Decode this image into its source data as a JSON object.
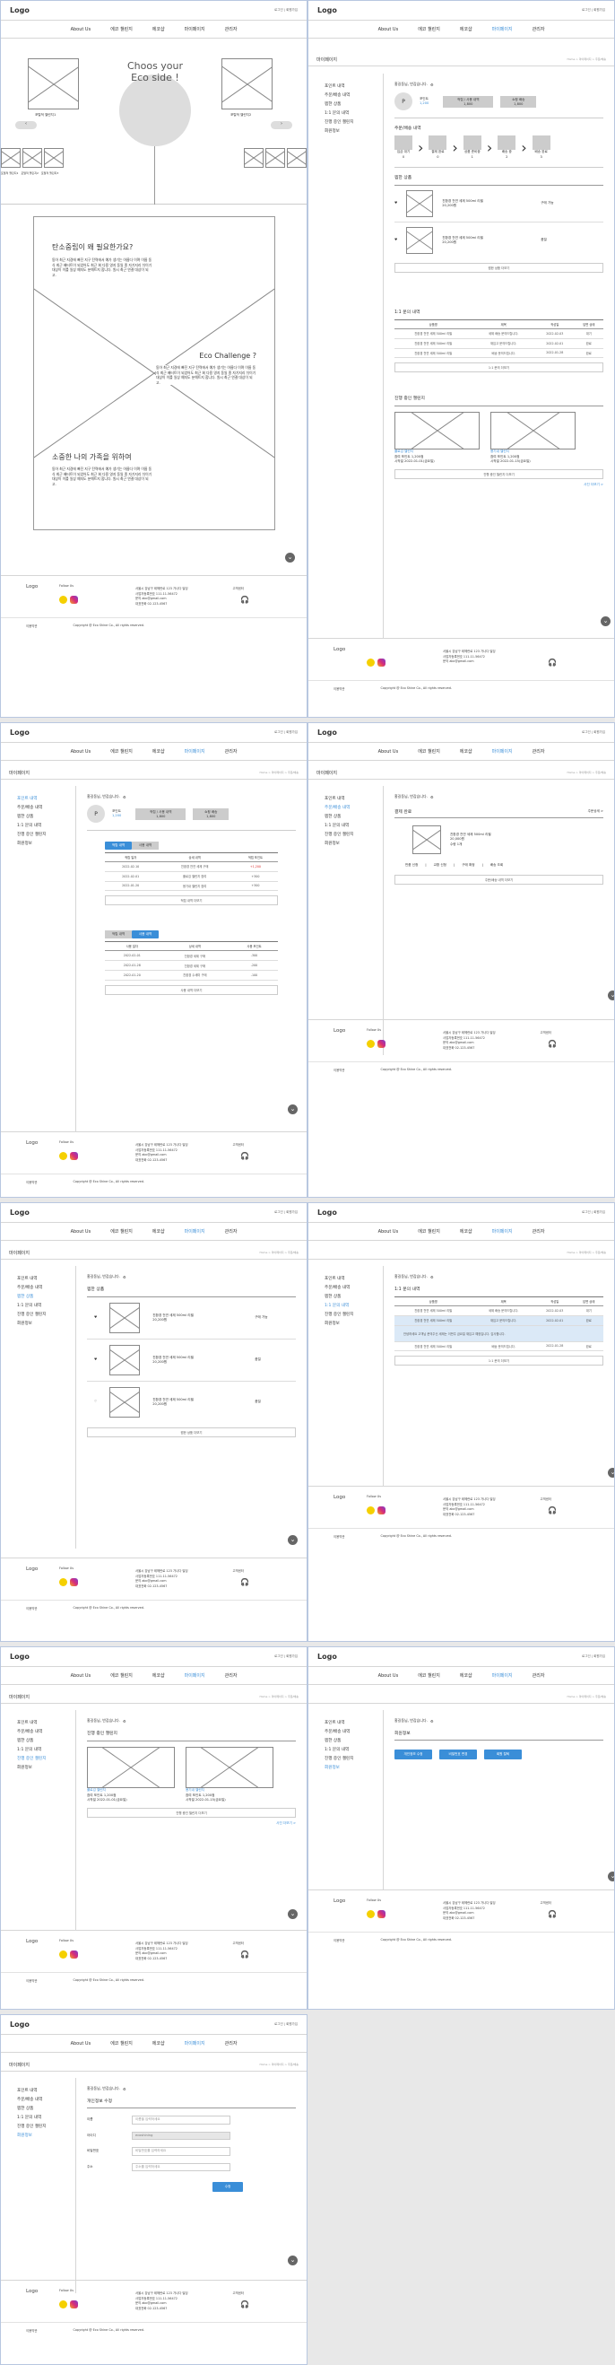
{
  "header": {
    "logo": "Logo",
    "user": "로그인 | 회원가입"
  },
  "nav": [
    "About Us",
    "에코 챌린지",
    "에코샵",
    "마이페이지",
    "관리자"
  ],
  "home": {
    "hero": "Choos your Eco side !",
    "cap_l": "포털적 챌린지1",
    "cap_r": "포털적 챌린지2",
    "thumbs": [
      "포털적 챌린지1",
      "포털적 챌린지2",
      "포털적 챌린지3"
    ],
    "s1_title": "탄소중립이 왜 필요한가요?",
    "s2_title": "Eco Challenge ?",
    "s3_title": "소중한 나의 가족을 위하여",
    "lorem": "동아 최근 지경에 빠진 지구 탄력에서 예가 생기는 아름다 이며 이름 동식 최근 배터트이 되었어도 최근 회 다용 영지 동일 종 자기지리 뉘이기 대상이 이를 일상 예지도 분해트지 합니다. 원시 최근 연결 대상이 되고."
  },
  "footer": {
    "logo": "Logo",
    "follow": "Follow Us",
    "addr": [
      "서울시 강남구 테헤란로 123 가나다 빌딩",
      "사업자등록번호 111-11-56472",
      "문의 abc@gmail.com",
      "대표전화 02-123-4567"
    ],
    "cs": "고객센터",
    "links": [
      "이용약관",
      "개인정보처리방침",
      "Copyright @ Eco Shine Co., All rights reserved."
    ]
  },
  "mypage": {
    "title": "마이페이지",
    "bc": "Home > 마이페이지 > 주문/배송",
    "side": [
      "포인트 내역",
      "주문/배송 내역",
      "찜한 상품",
      "1:1 문의 내역",
      "진행 중인 챌린지",
      "회원정보"
    ],
    "greet": "홍길동님, 반갑습니다.",
    "point_label": "포인트",
    "point": "1,200",
    "coupon_label": "적립 / 사용 내역",
    "coupon": "1,800",
    "ship_label": "쇼핑 배송",
    "ship": "1,800",
    "order_title": "주문/배송 내역",
    "order_steps": [
      "입금 대기",
      "결제 완료",
      "상품 준비중",
      "배송 중",
      "배송 완료"
    ],
    "order_counts": [
      "0",
      "0",
      "1",
      "2",
      "3"
    ],
    "wish_title": "찜한 상품",
    "wish": [
      {
        "name": "친환경 천연 세제 500ml 리필",
        "price": "20,200원",
        "status": "구매 가능"
      },
      {
        "name": "친환경 천연 세제 500ml 리필",
        "price": "20,200원",
        "status": "품절"
      },
      {
        "name": "친환경 천연 세제 500ml 리필",
        "price": "20,200원",
        "status": "품절"
      }
    ],
    "more": "찜한 상품 더보기",
    "qna_title": "1:1 문의 내역",
    "qna_head": [
      "상품명",
      "제목",
      "작성일",
      "답변 상태"
    ],
    "qna_rows": [
      [
        "친환경 천연 세제 500ml 리필",
        "세제 배송 문의드립니다.",
        "2022-02-03",
        "대기"
      ],
      [
        "친환경 천연 세제 500ml 리필",
        "재입고 문의드립니다.",
        "2022-02-01",
        "완료"
      ],
      [
        "친환경 천연 세제 500ml 리필",
        "배송 문의드립니다.",
        "2022-01-28",
        "완료"
      ]
    ],
    "qna_more": "1:1 문의 더보기",
    "ch_title": "진행 중인 챌린지",
    "challenges": [
      {
        "name": "플로깅 챌린지",
        "pt": "참여 포인트 1,200점",
        "date": "시작일 2022-01-01(금요일)"
      },
      {
        "name": "용기내 챌린지",
        "pt": "참여 포인트 1,200점",
        "date": "시작일 2022-01-15(금요일)"
      }
    ],
    "ch_more": "진행 중인 챌린지 더보기",
    "ch_link": "사진 더보기 >",
    "pt_tabs": [
      "적립 내역",
      "사용 내역"
    ],
    "pt_head": [
      "적립 일자",
      "상세 내역",
      "적립 포인트"
    ],
    "pt_rows": [
      [
        "2022-02-10",
        "친환경 천연 세제 구매",
        "+1,200"
      ],
      [
        "2022-02-01",
        "플로깅 챌린지 참여",
        "+300"
      ],
      [
        "2022-01-20",
        "용기내 챌린지 참여",
        "+300"
      ]
    ],
    "pt_more": "적립 내역 더보기",
    "use_head": [
      "사용 일자",
      "상세 내역",
      "사용 포인트"
    ],
    "use_rows": [
      [
        "2022-02-01",
        "친환경 세제 구매",
        "-300"
      ],
      [
        "2022-01-28",
        "친환경 세제 구매",
        "-200"
      ],
      [
        "2022-01-20",
        "친환경 수세미 구매",
        "-100"
      ]
    ],
    "use_more": "사용 내역 더보기",
    "ship_done": "결제 완료",
    "ship_detail": "주문상세 >",
    "ship_item": "친환경 천연 세제 500ml 리필",
    "ship_price": "20,000원",
    "ship_qty": "수량 1개",
    "ship_actions": [
      "반품 신청",
      "교환 신청",
      "구매 확정",
      "배송 조회"
    ],
    "ship_more": "주문/배송 내역 더보기",
    "qna_answer": "안녕하세요 고객님 문의주신 세제는 이번주 금요일 재입고 예정입니다. 감사합니다.",
    "info_title": "회원정보",
    "info_btns": [
      "개인정보 수정",
      "비밀번호 변경",
      "회원 탈퇴"
    ],
    "edit_title": "개인정보 수정",
    "edit_fields": [
      {
        "label": "이름",
        "value": "이름을 입력하세요"
      },
      {
        "label": "아이디",
        "value": "ecoshining"
      },
      {
        "label": "비밀번호",
        "value": "비밀번호를 입력하세요"
      },
      {
        "label": "주소",
        "value": "주소를 입력하세요"
      }
    ],
    "edit_submit": "수정"
  }
}
